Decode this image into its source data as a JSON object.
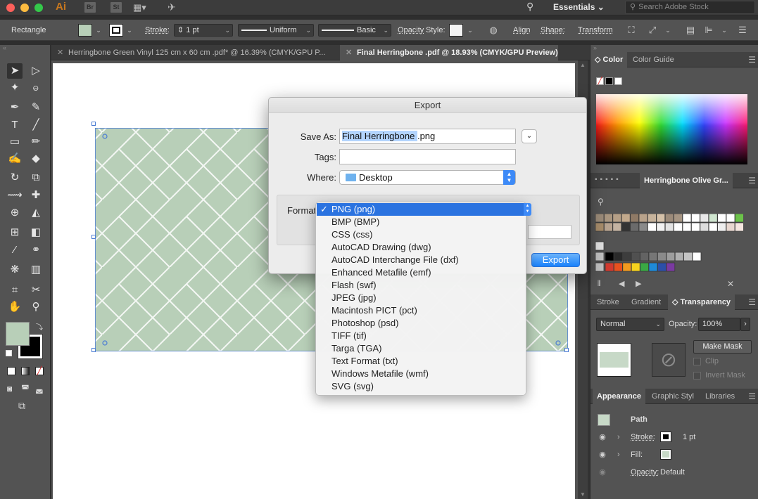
{
  "app": {
    "logo": "Ai",
    "bridge_icon": "Br",
    "stock_icon": "St",
    "workspace": "Essentials",
    "search_placeholder": "Search Adobe Stock"
  },
  "control_bar": {
    "object_type": "Rectangle",
    "stroke_label": "Stroke:",
    "stroke_weight": "1 pt",
    "profile": "Uniform",
    "brush": "Basic",
    "opacity_label": "Opacity",
    "style_label": "Style:",
    "align": "Align",
    "shape": "Shape:",
    "transform": "Transform"
  },
  "tabs": [
    {
      "label": "Herringbone Green Vinyl 125 cm x 60 cm .pdf* @ 16.39% (CMYK/GPU P..."
    },
    {
      "label": "Final Herringbone .pdf @ 18.93% (CMYK/GPU Preview)"
    }
  ],
  "dialog": {
    "title": "Export",
    "save_as_label": "Save As:",
    "save_as_selected": "Final Herringbone ",
    "save_as_ext": ".png",
    "tags_label": "Tags:",
    "tags_value": "",
    "where_label": "Where:",
    "where_value": "Desktop",
    "format_label": "Format",
    "export_button": "Export"
  },
  "format_menu": {
    "check": "✓",
    "items": [
      "PNG (png)",
      "BMP (BMP)",
      "CSS (css)",
      "AutoCAD Drawing (dwg)",
      "AutoCAD Interchange File (dxf)",
      "Enhanced Metafile (emf)",
      "Flash (swf)",
      "JPEG (jpg)",
      "Macintosh PICT (pct)",
      "Photoshop (psd)",
      "TIFF (tif)",
      "Targa (TGA)",
      "Text Format (txt)",
      "Windows Metafile (wmf)",
      "SVG (svg)"
    ],
    "selected": "PNG (png)"
  },
  "panels": {
    "color_tabs": [
      "Color",
      "Color Guide"
    ],
    "swatch_library": "Herringbone Olive Gr...",
    "transparency_tabs": [
      "Stroke",
      "Gradient",
      "Transparency"
    ],
    "blend_mode": "Normal",
    "opacity_label": "Opacity:",
    "opacity_value": "100%",
    "make_mask": "Make Mask",
    "clip": "Clip",
    "invert_mask": "Invert Mask",
    "appearance_tabs": [
      "Appearance",
      "Graphic Styl",
      "Libraries"
    ],
    "appearance_path": "Path",
    "stroke_label": "Stroke:",
    "stroke_value": "1 pt",
    "fill_label": "Fill:",
    "opacity_row_label": "Opacity:",
    "opacity_row_value": "Default"
  },
  "colors": {
    "herringbone_bg": "#b8cfb8",
    "herringbone_line": "#f4f7f4",
    "selection": "#4a7cd4",
    "accent_blue": "#2b73e0"
  }
}
